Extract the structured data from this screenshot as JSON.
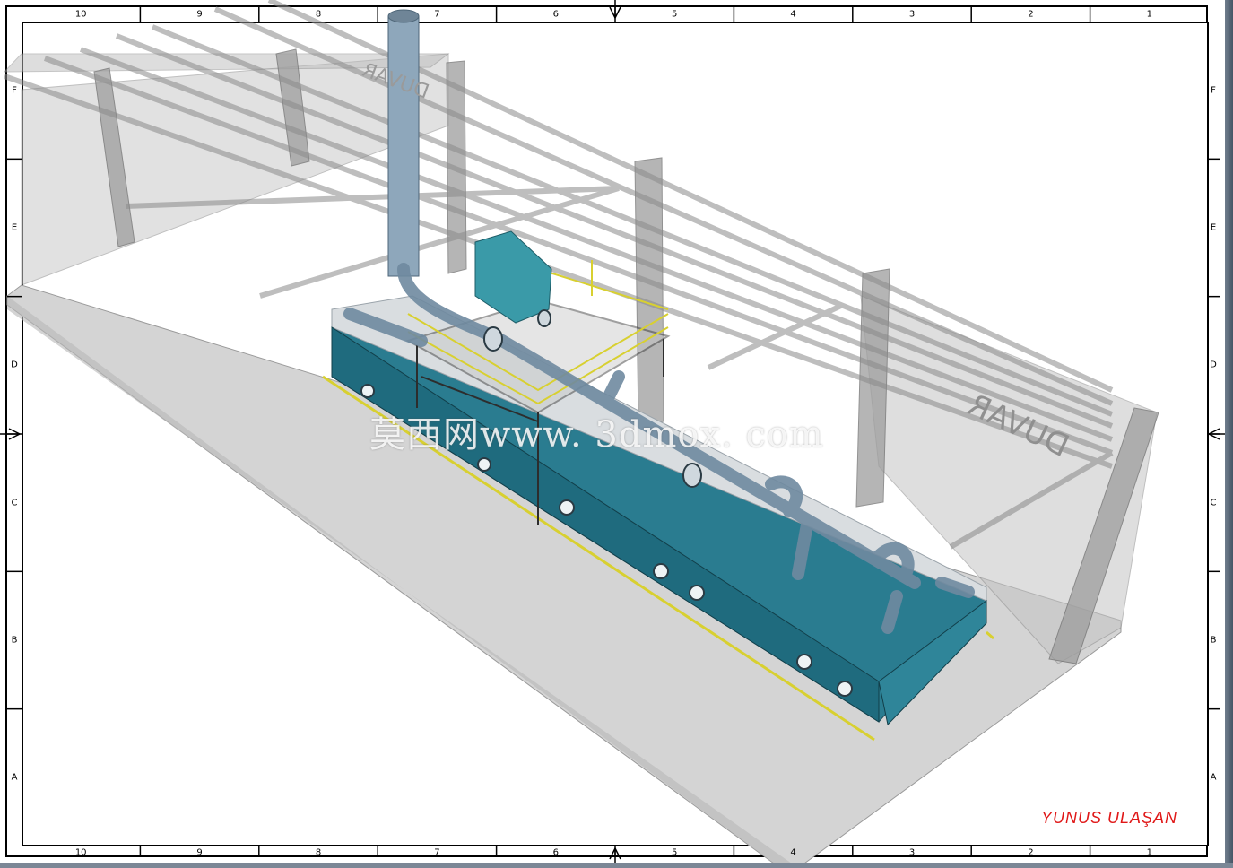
{
  "drawing": {
    "columns_top": [
      "10",
      "9",
      "8",
      "7",
      "6",
      "5",
      "4",
      "3",
      "2",
      "1"
    ],
    "columns_bottom": [
      "10",
      "9",
      "8",
      "7",
      "6",
      "5",
      "4",
      "3",
      "2",
      "1"
    ],
    "rows_left": [
      "F",
      "E",
      "D",
      "C",
      "B",
      "A"
    ],
    "rows_right": [
      "F",
      "E",
      "D",
      "C",
      "B",
      "A"
    ],
    "author": "YUNUS ULAŞAN",
    "author_color": "#e01818",
    "watermark": "莫西网www. 3dmox. com",
    "wall_text_upper": "DUVAR",
    "wall_text_right": "DUVAR"
  },
  "colors": {
    "oven_body": "#2a7c90",
    "duct": "#8ea7bb",
    "hood": "#3a9aa8",
    "rail": "#d8d030",
    "floor": "#d6d6d6",
    "glass": "#bdbdbd"
  }
}
